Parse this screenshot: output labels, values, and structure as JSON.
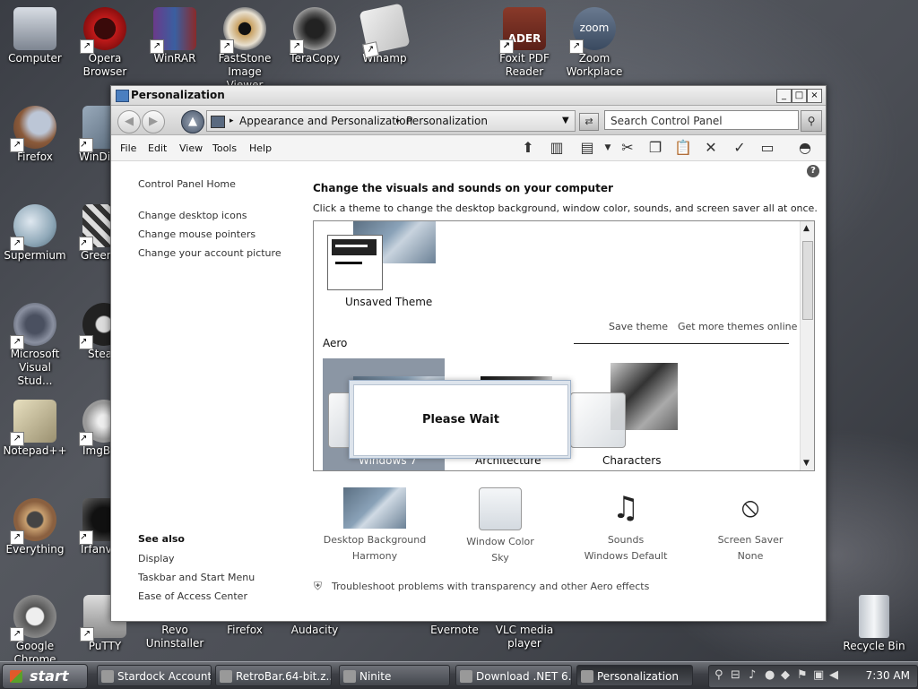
{
  "desktop": {
    "icons": [
      {
        "label": "Computer"
      },
      {
        "label": "Opera Browser"
      },
      {
        "label": "WinRAR"
      },
      {
        "label": "FastStone Image Viewer"
      },
      {
        "label": "TeraCopy"
      },
      {
        "label": "Winamp"
      },
      {
        "label": "Foxit PDF Reader"
      },
      {
        "label": "Zoom Workplace"
      },
      {
        "label": "Firefox"
      },
      {
        "label": "WinDi"
      },
      {
        "label": "Supermium"
      },
      {
        "label": "Green"
      },
      {
        "label": "Microsoft Visual Stud..."
      },
      {
        "label": "Stea"
      },
      {
        "label": "Notepad++"
      },
      {
        "label": "ImgB"
      },
      {
        "label": "Everything"
      },
      {
        "label": "Irfanv"
      },
      {
        "label": "Google Chrome"
      },
      {
        "label": "PuTTY"
      },
      {
        "label": "Revo Uninstaller"
      },
      {
        "label": "Firefox"
      },
      {
        "label": "Audacity"
      },
      {
        "label": "Evernote"
      },
      {
        "label": "VLC media player"
      },
      {
        "label": "Recycle Bin"
      }
    ],
    "zoom_logo_text": "zoom",
    "foxit_logo_text": "ADER"
  },
  "window": {
    "title": "Personalization",
    "controls": {
      "minimize": "_",
      "maximize": "□",
      "close": "×"
    },
    "breadcrumb": {
      "part1": "Appearance and Personalization",
      "separator": "▸",
      "part2": "Personalization"
    },
    "search": {
      "placeholder": "Search Control Panel"
    },
    "menu": [
      "File",
      "Edit",
      "View",
      "Tools",
      "Help"
    ],
    "help_glyph": "?",
    "sidebar": {
      "home": "Control Panel Home",
      "links": [
        "Change desktop icons",
        "Change mouse pointers",
        "Change your account picture"
      ],
      "see_also_title": "See also",
      "see_also": [
        "Display",
        "Taskbar and Start Menu",
        "Ease of Access Center"
      ]
    },
    "main": {
      "heading": "Change the visuals and sounds on your computer",
      "description": "Click a theme to change the desktop background, window color, sounds, and screen saver all at once.",
      "unsaved_theme": "Unsaved Theme",
      "save_theme": "Save theme",
      "get_more": "Get more themes online",
      "aero_label": "Aero",
      "themes": [
        "Windows 7",
        "Architecture",
        "Characters"
      ]
    },
    "bottom": [
      {
        "title": "Desktop Background",
        "value": "Harmony"
      },
      {
        "title": "Window Color",
        "value": "Sky"
      },
      {
        "title": "Sounds",
        "value": "Windows Default"
      },
      {
        "title": "Screen Saver",
        "value": "None"
      }
    ],
    "troubleshoot": "Troubleshoot problems with transparency and other Aero effects",
    "dialog": {
      "message": "Please Wait"
    }
  },
  "taskbar": {
    "start": "start",
    "tasks": [
      "Stardock Account...",
      "RetroBar.64-bit.z...",
      "Ninite",
      "Download .NET 6...",
      "Personalization"
    ],
    "clock": "7:30 AM"
  },
  "colors": {
    "accent": "#4b7fc0",
    "taskbar": "#3e4046"
  }
}
